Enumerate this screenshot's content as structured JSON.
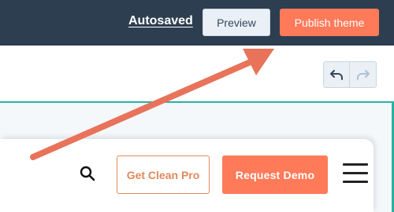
{
  "editor": {
    "autosaved_label": "Autosaved",
    "preview_label": "Preview",
    "publish_label": "Publish theme"
  },
  "toolbar": {
    "undo_icon": "undo-icon",
    "redo_icon": "redo-icon"
  },
  "site_preview": {
    "search_icon": "search-icon",
    "cta_secondary_label": "Get Clean Pro",
    "cta_primary_label": "Request Demo",
    "menu_icon": "hamburger-menu-icon"
  },
  "annotation": {
    "type": "arrow",
    "color": "#e8735a"
  },
  "colors": {
    "topbar_bg": "#2d3e50",
    "accent_orange": "#ff7a59",
    "canvas_border": "#27b3a4"
  }
}
